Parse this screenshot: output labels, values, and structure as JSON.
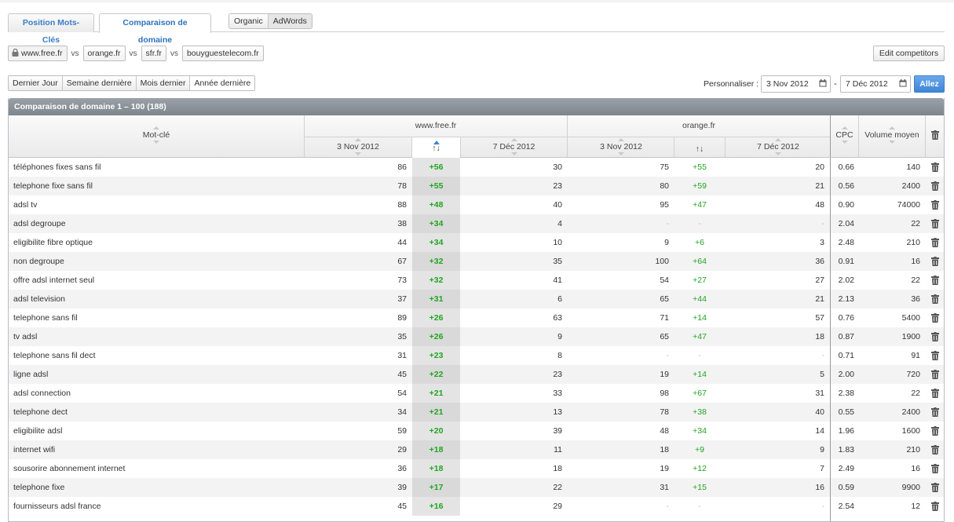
{
  "tabs": {
    "position": "Position Mots-Clés",
    "comparison": "Comparaison de domaine"
  },
  "source": {
    "organic": "Organic",
    "adwords": "AdWords"
  },
  "domains": {
    "main": "www.free.fr",
    "vs": "vs",
    "competitors": [
      "orange.fr",
      "sfr.fr",
      "bouyguestelecom.fr"
    ],
    "edit_button": "Edit competitors"
  },
  "periods": [
    "Dernier Jour",
    "Semaine dernière",
    "Mois dernier",
    "Année dernière"
  ],
  "date_range": {
    "label": "Personnaliser :",
    "from": "3 Nov 2012",
    "separator": "-",
    "to": "7 Déc 2012",
    "go": "Allez"
  },
  "table": {
    "title": "Comparaison de domaine 1 – 100 (188)",
    "headers": {
      "keyword": "Mot-clé",
      "domain1": "www.free.fr",
      "domain2": "orange.fr",
      "date_from": "3 Nov 2012",
      "date_to": "7 Déc 2012",
      "diff": "↑↓",
      "cpc": "CPC",
      "volume": "Volume moyen"
    },
    "rows": [
      {
        "kw": "téléphones fixes sans fil",
        "a1": "86",
        "ad": "+56",
        "a2": "30",
        "b1": "75",
        "bd": "+55",
        "b2": "20",
        "cpc": "0.66",
        "vol": "140"
      },
      {
        "kw": "telephone fixe sans fil",
        "a1": "78",
        "ad": "+55",
        "a2": "23",
        "b1": "80",
        "bd": "+59",
        "b2": "21",
        "cpc": "0.56",
        "vol": "2400"
      },
      {
        "kw": "adsl tv",
        "a1": "88",
        "ad": "+48",
        "a2": "40",
        "b1": "95",
        "bd": "+47",
        "b2": "48",
        "cpc": "0.90",
        "vol": "74000"
      },
      {
        "kw": "adsl degroupe",
        "a1": "38",
        "ad": "+34",
        "a2": "4",
        "b1": "-",
        "bd": "-",
        "b2": "-",
        "cpc": "2.04",
        "vol": "22"
      },
      {
        "kw": "eligibilite fibre optique",
        "a1": "44",
        "ad": "+34",
        "a2": "10",
        "b1": "9",
        "bd": "+6",
        "b2": "3",
        "cpc": "2.48",
        "vol": "210"
      },
      {
        "kw": "non degroupe",
        "a1": "67",
        "ad": "+32",
        "a2": "35",
        "b1": "100",
        "bd": "+64",
        "b2": "36",
        "cpc": "0.91",
        "vol": "16"
      },
      {
        "kw": "offre adsl internet seul",
        "a1": "73",
        "ad": "+32",
        "a2": "41",
        "b1": "54",
        "bd": "+27",
        "b2": "27",
        "cpc": "2.02",
        "vol": "22"
      },
      {
        "kw": "adsl television",
        "a1": "37",
        "ad": "+31",
        "a2": "6",
        "b1": "65",
        "bd": "+44",
        "b2": "21",
        "cpc": "2.13",
        "vol": "36"
      },
      {
        "kw": "telephone sans fil",
        "a1": "89",
        "ad": "+26",
        "a2": "63",
        "b1": "71",
        "bd": "+14",
        "b2": "57",
        "cpc": "0.76",
        "vol": "5400"
      },
      {
        "kw": "tv adsl",
        "a1": "35",
        "ad": "+26",
        "a2": "9",
        "b1": "65",
        "bd": "+47",
        "b2": "18",
        "cpc": "0.87",
        "vol": "1900"
      },
      {
        "kw": "telephone sans fil dect",
        "a1": "31",
        "ad": "+23",
        "a2": "8",
        "b1": "-",
        "bd": "-",
        "b2": "-",
        "cpc": "0.71",
        "vol": "91"
      },
      {
        "kw": "ligne adsl",
        "a1": "45",
        "ad": "+22",
        "a2": "23",
        "b1": "19",
        "bd": "+14",
        "b2": "5",
        "cpc": "2.00",
        "vol": "720"
      },
      {
        "kw": "adsl connection",
        "a1": "54",
        "ad": "+21",
        "a2": "33",
        "b1": "98",
        "bd": "+67",
        "b2": "31",
        "cpc": "2.38",
        "vol": "22"
      },
      {
        "kw": "telephone dect",
        "a1": "34",
        "ad": "+21",
        "a2": "13",
        "b1": "78",
        "bd": "+38",
        "b2": "40",
        "cpc": "0.55",
        "vol": "2400"
      },
      {
        "kw": "eligibilite adsl",
        "a1": "59",
        "ad": "+20",
        "a2": "39",
        "b1": "48",
        "bd": "+34",
        "b2": "14",
        "cpc": "1.96",
        "vol": "1600"
      },
      {
        "kw": "internet wifi",
        "a1": "29",
        "ad": "+18",
        "a2": "11",
        "b1": "18",
        "bd": "+9",
        "b2": "9",
        "cpc": "1.83",
        "vol": "210"
      },
      {
        "kw": "sousorire abonnement internet",
        "a1": "36",
        "ad": "+18",
        "a2": "18",
        "b1": "19",
        "bd": "+12",
        "b2": "7",
        "cpc": "2.49",
        "vol": "16"
      },
      {
        "kw": "telephone fixe",
        "a1": "39",
        "ad": "+17",
        "a2": "22",
        "b1": "31",
        "bd": "+15",
        "b2": "16",
        "cpc": "0.59",
        "vol": "9900"
      },
      {
        "kw": "fournisseurs adsl france",
        "a1": "45",
        "ad": "+16",
        "a2": "29",
        "b1": "-",
        "bd": "-",
        "b2": "-",
        "cpc": "2.54",
        "vol": "12"
      }
    ]
  }
}
